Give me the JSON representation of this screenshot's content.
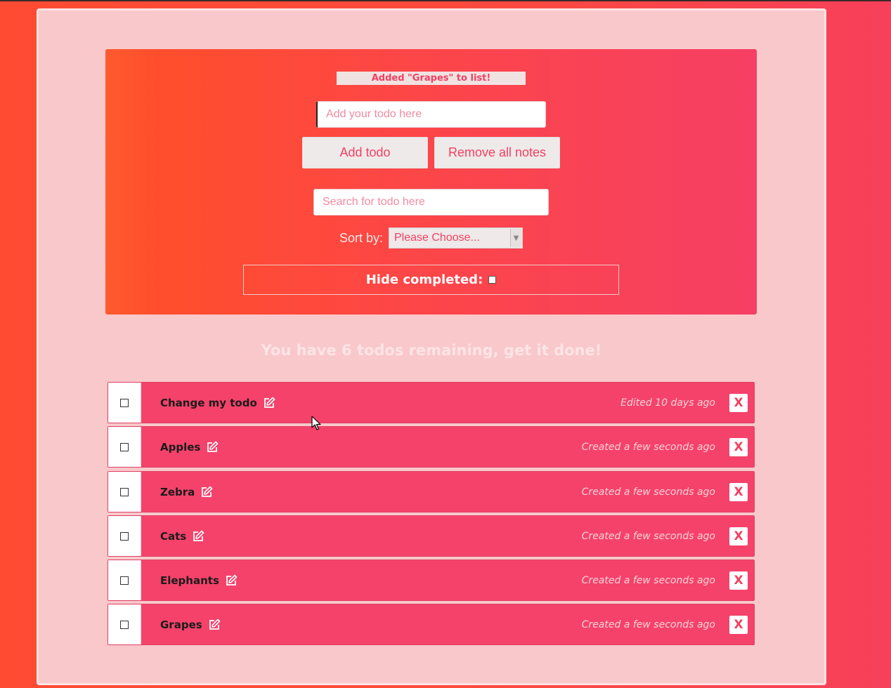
{
  "flash_message": "Added \"Grapes\" to list!",
  "add_form": {
    "placeholder": "Add your todo here",
    "value": "",
    "add_button_label": "Add todo",
    "remove_all_label": "Remove all notes"
  },
  "search": {
    "placeholder": "Search for todo here",
    "value": ""
  },
  "sort": {
    "label": "Sort by:",
    "selected": "Please Choose..."
  },
  "hide_completed": {
    "label": "Hide completed:",
    "checked": false
  },
  "remaining_text": "You have 6 todos remaining, get it done!",
  "todos": [
    {
      "text": "Change my todo",
      "meta": "Edited 10 days ago",
      "completed": false,
      "delete_label": "X"
    },
    {
      "text": "Apples",
      "meta": "Created a few seconds ago",
      "completed": false,
      "delete_label": "X"
    },
    {
      "text": "Zebra",
      "meta": "Created a few seconds ago",
      "completed": false,
      "delete_label": "X"
    },
    {
      "text": "Cats",
      "meta": "Created a few seconds ago",
      "completed": false,
      "delete_label": "X"
    },
    {
      "text": "Elephants",
      "meta": "Created a few seconds ago",
      "completed": false,
      "delete_label": "X"
    },
    {
      "text": "Grapes",
      "meta": "Created a few seconds ago",
      "completed": false,
      "delete_label": "X"
    }
  ],
  "colors": {
    "accent": "#f24062",
    "row_background": "#f4426b",
    "card_background": "#f9c8cb"
  },
  "icons": {
    "edit": "edit-icon",
    "cursor": "mouse-pointer-icon"
  }
}
